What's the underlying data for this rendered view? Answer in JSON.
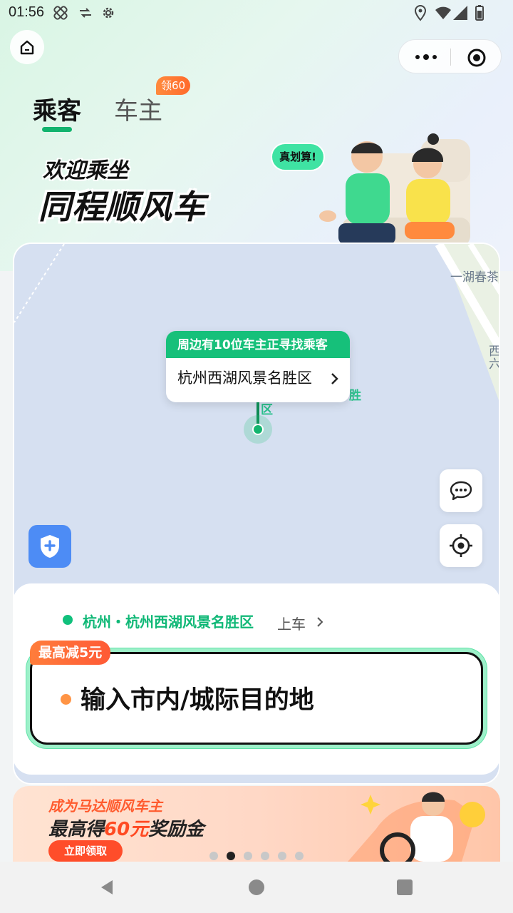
{
  "status_bar": {
    "time": "01:56",
    "icons": [
      "cross-bandage-icon",
      "signal-arrows-icon",
      "gear-icon",
      "location-icon",
      "wifi-icon",
      "cellular-icon",
      "battery-icon"
    ]
  },
  "header": {
    "home_icon": "home-icon",
    "more_icon": "more-dots-icon",
    "close_icon": "target-icon"
  },
  "tabs": [
    {
      "label": "乘客",
      "active": true
    },
    {
      "label": "车主",
      "active": false,
      "badge": "领60"
    }
  ],
  "banner": {
    "line1": "欢迎乘坐",
    "line2": "同程顺风车",
    "speech": "真划算!"
  },
  "map": {
    "road_label_1": "一湖春茶",
    "road_label_2": "西",
    "road_label_3": "六",
    "poi_1": "胜",
    "poi_2": "区",
    "tooltip_title": "周边有10位车主正寻找乘客",
    "tooltip_location": "杭州西湖风景名胜区",
    "chat_icon": "chat-bubble-icon",
    "locate_icon": "locate-crosshair-icon",
    "safety_icon": "shield-plus-icon"
  },
  "panel": {
    "pickup_location": "杭州・杭州西湖风景名胜区",
    "pickup_action": "上车",
    "promo_tag": "最高减5元",
    "destination_placeholder": "输入市内/城际目的地"
  },
  "promo_banner": {
    "line1": "成为马达顺风车主",
    "line2_prefix": "最高得",
    "line2_amount": "60元",
    "line2_suffix": "奖励金",
    "cta": "立即领取"
  },
  "carousel": {
    "count": 6,
    "active_index": 1
  },
  "colors": {
    "brand_green": "#12b36e",
    "tooltip_green": "#16c07a",
    "orange": "#ff6a2b",
    "shield_blue": "#4d8cf5"
  }
}
